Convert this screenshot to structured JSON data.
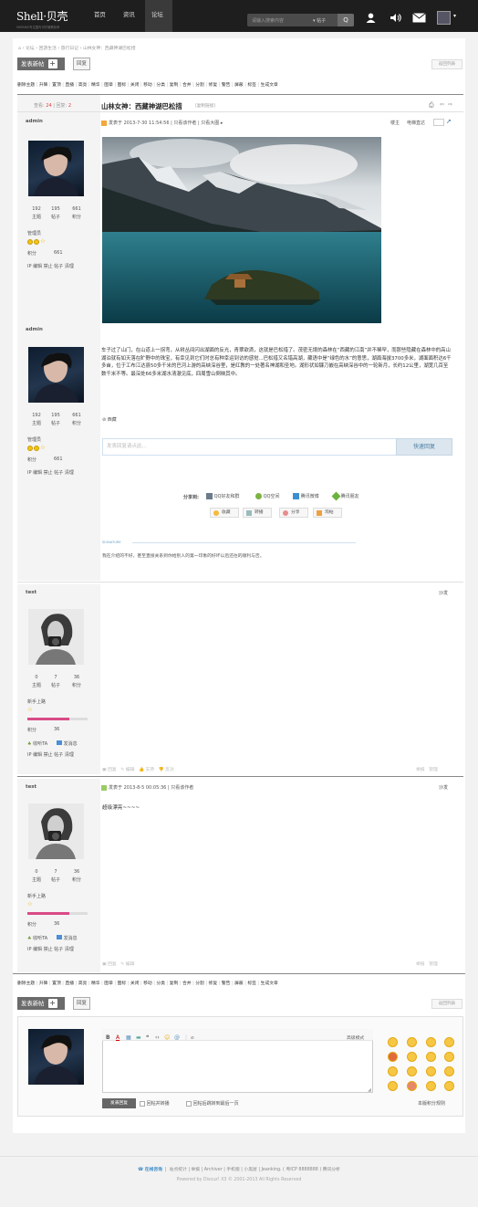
{
  "header": {
    "logo": "Shell·贝壳",
    "logo_sub": "SHEBING专注国内·好的佛教前辈",
    "nav": [
      "首页",
      "资讯",
      "论坛"
    ],
    "search_placeholder": "请输入搜索内容",
    "search_type": "帖子",
    "search_button": "Q"
  },
  "breadcrumb": [
    "论坛",
    "回游生活",
    "旅行日记",
    "山林女神：西藏神湖巴松措"
  ],
  "toolbar": {
    "new_post": "发表新帖",
    "reply": "回复",
    "back_list": "返回列表"
  },
  "mod_actions": [
    "删除主题",
    "升降",
    "置顶",
    "直播",
    "高亮",
    "精华",
    "图章",
    "图标",
    "关闭",
    "移动",
    "分类",
    "复制",
    "合并",
    "分割",
    "修复",
    "警告",
    "屏蔽",
    "标签",
    "生成文章"
  ],
  "thread": {
    "views_label": "查看:",
    "views": "24",
    "replies_label": "回复:",
    "replies": "2",
    "title": "山林女神：西藏神湖巴松措",
    "copy_link": "[复制链接]",
    "print_icon": "打印",
    "prev": "上一主题",
    "next": "下一主题"
  },
  "post1": {
    "author": "admin",
    "meta": "发表于 2013-7-30 11:54:56",
    "only_author": "只看该作者",
    "only_big": "只看大图",
    "floor": "楼主",
    "jump": "电梯直达",
    "stats": {
      "topics": "192",
      "posts": "195",
      "credits": "661",
      "l_topics": "主题",
      "l_posts": "帖子",
      "l_credits": "积分"
    },
    "group": "管理员",
    "credits_label": "积分",
    "credits_value": "661",
    "admin_links": "IP 编辑 禁止 帖子 清理",
    "text": "车子过了山门，在山道上一拐弯，从树丛间闪出湖面的反光，青翠欲滴，这就是巴松措了。茂密无垠的森林在“西藏的江南”并不稀罕，而那些隐藏在森林中的高山湖泊就有如天落在旷野中的珠宝，有幸见到它们时总有种幸运到访的感觉...巴松措又名错高湖，藏语中是“绿色的水”的意思，湖面海拔3700多米，湖面面积达6千多亩，位于工布江达县50多千米的巴河上游的高峡深谷里，是红教的一处著名神湖和圣地。湖形状如镰刀嵌在高峡深谷中的一轮新月，长约12公里，湖宽几百至数千米不等。最深处66多米湖水清澈见底，四周雪山倒映其中。",
    "tag": "西藏",
    "quick_reply_placeholder": "发表回复请点此...",
    "quick_reply_button": "快速回复",
    "share_label": "分享到:",
    "share": [
      "QQ好友和群",
      "QQ空间",
      "腾讯微博",
      "腾讯朋友"
    ],
    "actions": [
      "收藏",
      "转播",
      "分享",
      "淘帖"
    ],
    "signature_label": "SIGNATURE",
    "signature": "我在介绍的不好，甚至直接关系到你给别人的第一印象的好坏以后还往的顺利与否。"
  },
  "post1b": {
    "author": "admin",
    "stats": {
      "topics": "192",
      "posts": "195",
      "credits": "661",
      "l_topics": "主题",
      "l_posts": "帖子",
      "l_credits": "积分"
    },
    "group": "管理员",
    "credits_label": "积分",
    "credits_value": "661",
    "admin_links": "IP 编辑 禁止 帖子 清理"
  },
  "post2": {
    "author": "test",
    "floor": "沙发",
    "stats": {
      "topics": "0",
      "posts": "7",
      "credits": "36",
      "l_topics": "主题",
      "l_posts": "帖子",
      "l_credits": "积分"
    },
    "group": "新手上路",
    "progress": 0.7,
    "credits_label": "积分",
    "credits_value": "36",
    "follow": "收听TA",
    "message": "发消息",
    "admin_links": "IP 编辑 禁止 帖子 清理",
    "actions": [
      "回复",
      "编辑",
      "支持",
      "反对"
    ],
    "right_actions": [
      "举报",
      "管理"
    ]
  },
  "post3": {
    "author": "test",
    "meta": "发表于 2013-8-5 00:05:36",
    "only_author": "只看该作者",
    "floor": "沙发",
    "text": "超级漂亮~~~~",
    "stats": {
      "topics": "0",
      "posts": "7",
      "credits": "36",
      "l_topics": "主题",
      "l_posts": "帖子",
      "l_credits": "积分"
    },
    "group": "新手上路",
    "progress": 0.7,
    "credits_label": "积分",
    "credits_value": "36",
    "follow": "收听TA",
    "message": "发消息",
    "admin_links": "IP 编辑 禁止 帖子 清理",
    "actions": [
      "回复",
      "编辑"
    ],
    "right_actions": [
      "举报",
      "管理"
    ]
  },
  "reply_box": {
    "advanced": "高级模式",
    "submit": "发表回复",
    "opt1": "回帖并转播",
    "opt2": "回帖后跳转到最后一页",
    "rules": "本版积分规则"
  },
  "footer": {
    "logo": "在线咨询",
    "links": "站点统计 | 举报 | Archiver | 手机版 | 小黑屋 | Jeanking. ( 粤ICP 8888888 ) 腾讯分析",
    "copyright": "Powered by Discuz! X3 © 2001-2013 All Rights Reserved"
  },
  "colors": {
    "topbar": "#1e1e1e",
    "accent": "#2d6f9e",
    "progress": "#d94b86"
  }
}
